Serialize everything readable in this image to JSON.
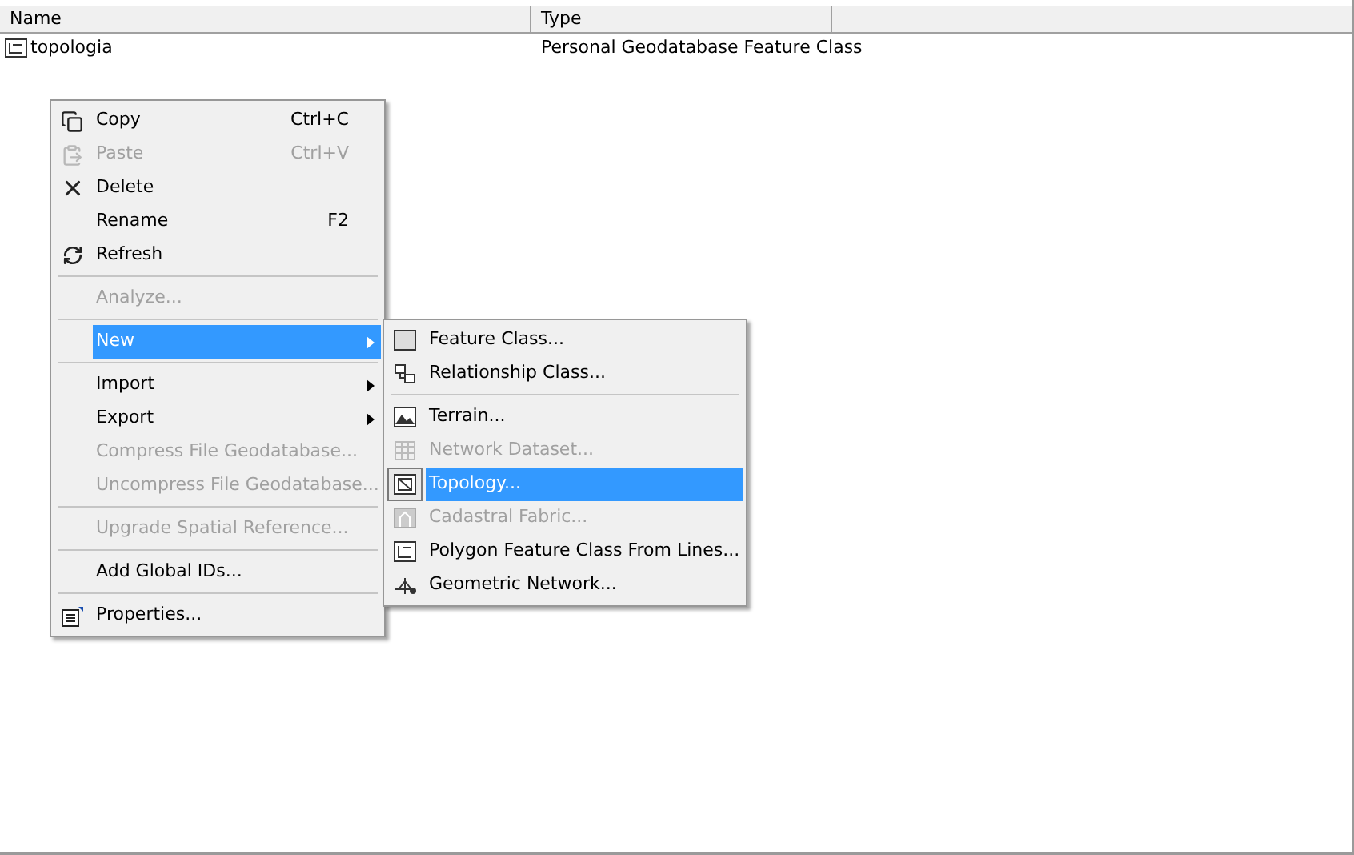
{
  "table": {
    "columns": [
      "Name",
      "Type"
    ],
    "rows": [
      {
        "name": "topologia",
        "type": "Personal Geodatabase Feature Class"
      }
    ]
  },
  "context_menu": {
    "items": [
      {
        "kind": "item",
        "label": "Copy",
        "shortcut": "Ctrl+C",
        "disabled": false,
        "selected": false,
        "submenu": false
      },
      {
        "kind": "item",
        "label": "Paste",
        "shortcut": "Ctrl+V",
        "disabled": true,
        "selected": false,
        "submenu": false
      },
      {
        "kind": "item",
        "label": "Delete",
        "disabled": false,
        "selected": false,
        "submenu": false
      },
      {
        "kind": "item",
        "label": "Rename",
        "shortcut": "F2",
        "disabled": false,
        "selected": false,
        "submenu": false
      },
      {
        "kind": "item",
        "label": "Refresh",
        "disabled": false,
        "selected": false,
        "submenu": false
      },
      {
        "kind": "separator"
      },
      {
        "kind": "item",
        "label": "Analyze...",
        "disabled": true,
        "selected": false,
        "submenu": false
      },
      {
        "kind": "separator"
      },
      {
        "kind": "item",
        "label": "New",
        "disabled": false,
        "selected": true,
        "submenu": true
      },
      {
        "kind": "separator"
      },
      {
        "kind": "item",
        "label": "Import",
        "disabled": false,
        "selected": false,
        "submenu": true
      },
      {
        "kind": "item",
        "label": "Export",
        "disabled": false,
        "selected": false,
        "submenu": true
      },
      {
        "kind": "item",
        "label": "Compress File Geodatabase...",
        "disabled": true,
        "selected": false,
        "submenu": false
      },
      {
        "kind": "item",
        "label": "Uncompress File Geodatabase...",
        "disabled": true,
        "selected": false,
        "submenu": false
      },
      {
        "kind": "separator"
      },
      {
        "kind": "item",
        "label": "Upgrade Spatial Reference...",
        "disabled": true,
        "selected": false,
        "submenu": false
      },
      {
        "kind": "separator"
      },
      {
        "kind": "item",
        "label": "Add Global IDs...",
        "disabled": false,
        "selected": false,
        "submenu": false
      },
      {
        "kind": "separator"
      },
      {
        "kind": "item",
        "label": "Properties...",
        "disabled": false,
        "selected": false,
        "submenu": false
      }
    ]
  },
  "submenu": {
    "items": [
      {
        "kind": "item",
        "label": "Feature Class...",
        "disabled": false,
        "selected": false
      },
      {
        "kind": "item",
        "label": "Relationship Class...",
        "disabled": false,
        "selected": false
      },
      {
        "kind": "separator"
      },
      {
        "kind": "item",
        "label": "Terrain...",
        "disabled": false,
        "selected": false
      },
      {
        "kind": "item",
        "label": "Network Dataset...",
        "disabled": true,
        "selected": false
      },
      {
        "kind": "item",
        "label": "Topology...",
        "disabled": false,
        "selected": true
      },
      {
        "kind": "item",
        "label": "Cadastral Fabric...",
        "disabled": true,
        "selected": false
      },
      {
        "kind": "item",
        "label": "Polygon Feature Class From Lines...",
        "disabled": false,
        "selected": false
      },
      {
        "kind": "item",
        "label": "Geometric Network...",
        "disabled": false,
        "selected": false
      }
    ]
  }
}
